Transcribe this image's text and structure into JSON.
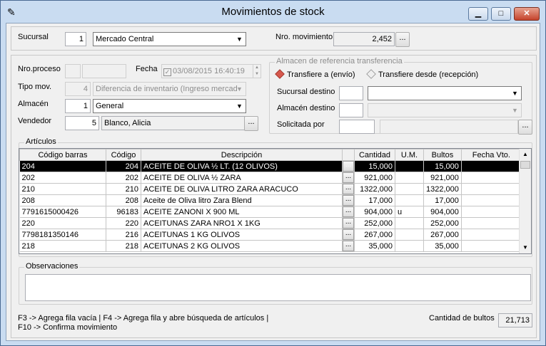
{
  "window": {
    "title": "Movimientos de stock",
    "minimize": "▁",
    "maximize": "□",
    "close": "✕"
  },
  "header": {
    "sucursal_label": "Sucursal",
    "sucursal_code": "1",
    "sucursal_name": "Mercado Central",
    "nro_movimiento_label": "Nro. movimiento",
    "nro_movimiento": "2,452",
    "browse": "..."
  },
  "form": {
    "nro_proceso_label": "Nro.proceso",
    "nro_proceso_a": "",
    "nro_proceso_b": "",
    "fecha_label": "Fecha",
    "fecha_value": "03/08/2015 16:40:19",
    "tipo_mov_label": "Tipo mov.",
    "tipo_mov_code": "4",
    "tipo_mov_name": "Diferencia de inventario (Ingreso mercad",
    "almacen_label": "Almacén",
    "almacen_code": "1",
    "almacen_name": "General",
    "vendedor_label": "Vendedor",
    "vendedor_code": "5",
    "vendedor_name": "Blanco, Alicia",
    "browse": "..."
  },
  "transfer": {
    "group_title": "Almacen de referencia transferencia",
    "radio_envio": "Transfiere a (envío)",
    "radio_recepcion": "Transfiere desde (recepción)",
    "sucursal_destino_label": "Sucursal destino",
    "almacen_destino_label": "Almacén destino",
    "solicitada_por_label": "Solicitada por",
    "browse": "..."
  },
  "articulos": {
    "group_title": "Artículos",
    "columns": [
      "Código barras",
      "Código",
      "Descripción",
      "",
      "Cantidad",
      "U.M.",
      "Bultos",
      "Fecha Vto."
    ],
    "rows": [
      {
        "barcode": "204",
        "code": "204",
        "desc": "ACEITE DE OLIVA ½ LT.  (12 OLIVOS)",
        "qty": "15,000",
        "um": "",
        "bultos": "15,000",
        "vto": ""
      },
      {
        "barcode": "202",
        "code": "202",
        "desc": "ACEITE DE OLIVA ½ ZARA",
        "qty": "921,000",
        "um": "",
        "bultos": "921,000",
        "vto": ""
      },
      {
        "barcode": "210",
        "code": "210",
        "desc": "ACEITE DE OLIVA LITRO ZARA ARACUCO",
        "qty": "1322,000",
        "um": "",
        "bultos": "1322,000",
        "vto": ""
      },
      {
        "barcode": "208",
        "code": "208",
        "desc": "Aceite de Oliva litro Zara Blend",
        "qty": "17,000",
        "um": "",
        "bultos": "17,000",
        "vto": ""
      },
      {
        "barcode": "7791615000426",
        "code": "96183",
        "desc": "ACEITE ZANONI X 900 ML",
        "qty": "904,000",
        "um": "u",
        "bultos": "904,000",
        "vto": ""
      },
      {
        "barcode": "220",
        "code": "220",
        "desc": "ACEITUNAS ZARA NRO1 X 1KG",
        "qty": "252,000",
        "um": "",
        "bultos": "252,000",
        "vto": ""
      },
      {
        "barcode": "7798181350146",
        "code": "216",
        "desc": "ACEITUNAS 1 KG OLIVOS",
        "qty": "267,000",
        "um": "",
        "bultos": "267,000",
        "vto": ""
      },
      {
        "barcode": "218",
        "code": "218",
        "desc": "ACEITUNAS 2 KG OLIVOS",
        "qty": "35,000",
        "um": "",
        "bultos": "35,000",
        "vto": ""
      }
    ],
    "row_button": "...",
    "scroll_up": "▲",
    "scroll_down": "▼"
  },
  "observaciones": {
    "group_title": "Observaciones",
    "value": ""
  },
  "footer": {
    "hint_line1": "F3 -> Agrega fila vacía  |  F4 -> Agrega fila y abre búsqueda de artículos  |",
    "hint_line2": "F10 -> Confirma movimiento",
    "bultos_label": "Cantidad de bultos",
    "bultos_total": "21,713"
  }
}
